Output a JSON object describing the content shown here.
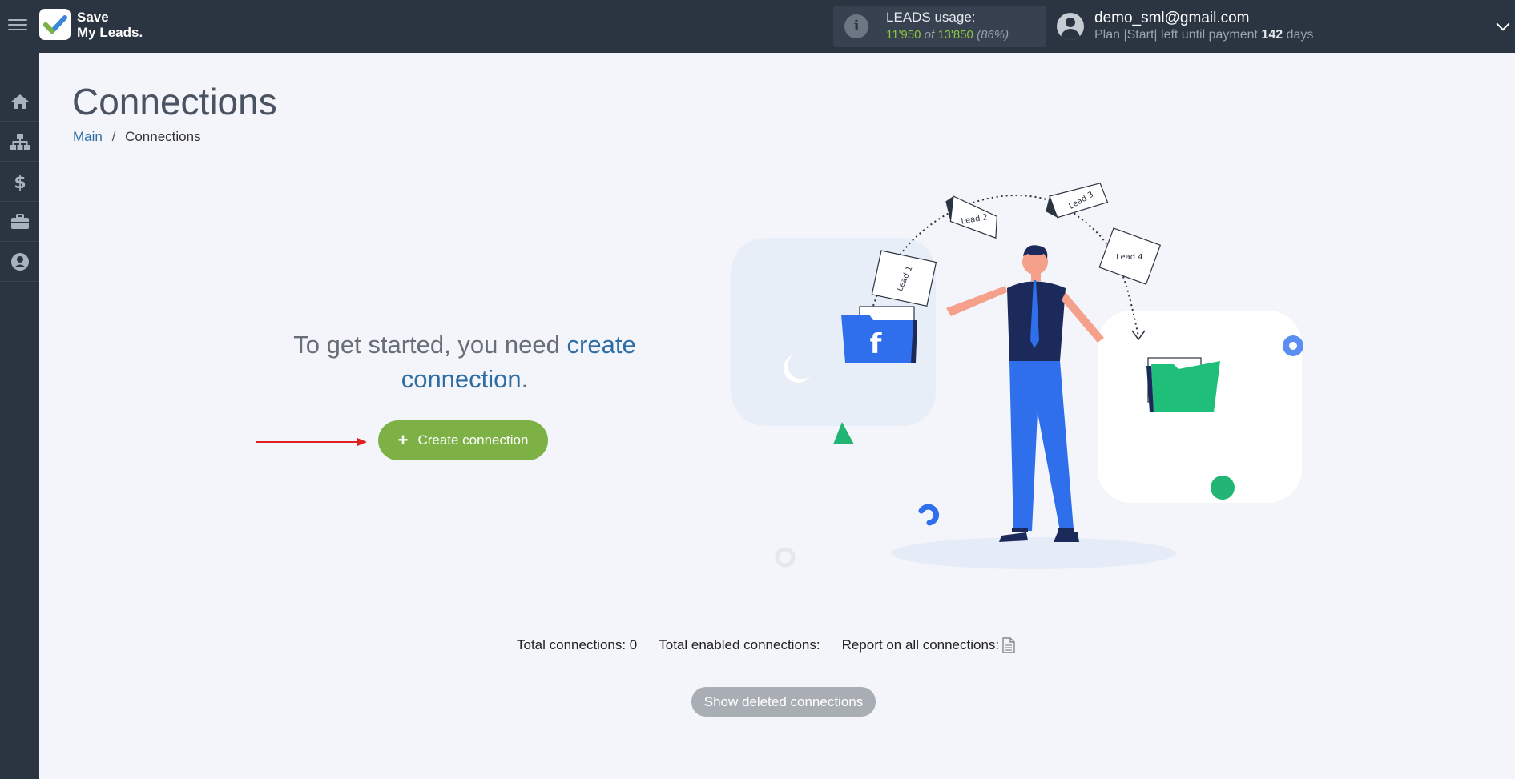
{
  "app": {
    "logo_line1": "Save",
    "logo_line2": "My Leads."
  },
  "header": {
    "usage_label": "LEADS usage:",
    "usage_used": "11'950",
    "usage_of": "of",
    "usage_total": "13'850",
    "usage_percent": "(86%)",
    "user_email": "demo_sml@gmail.com",
    "plan_text": "Plan |Start| left until payment",
    "plan_days": "142",
    "plan_days_suffix": "days"
  },
  "sidebar": {
    "items": [
      {
        "icon": "home-icon"
      },
      {
        "icon": "sitemap-icon"
      },
      {
        "icon": "dollar-icon"
      },
      {
        "icon": "briefcase-icon"
      },
      {
        "icon": "user-circle-icon"
      }
    ]
  },
  "main": {
    "title": "Connections",
    "breadcrumb": {
      "home": "Main",
      "separator": "/",
      "current": "Connections"
    },
    "intro_text": "To get started, you need",
    "intro_link": "create connection",
    "intro_end": ".",
    "create_button": "Create connection",
    "create_button_icon": "+",
    "illustration_labels": [
      "Lead 1",
      "Lead 2",
      "Lead 3",
      "Lead 4"
    ],
    "illustration_folder_letter": "f"
  },
  "footer": {
    "total_connections": "Total connections: 0",
    "total_enabled": "Total enabled connections:",
    "report_label": "Report on all connections:",
    "show_deleted": "Show deleted connections"
  },
  "colors": {
    "topbar": "#2b3441",
    "accent_green": "#7db146",
    "link_blue": "#2e6da4",
    "usage_green": "#8cc63f",
    "background": "#f3f5fa"
  }
}
